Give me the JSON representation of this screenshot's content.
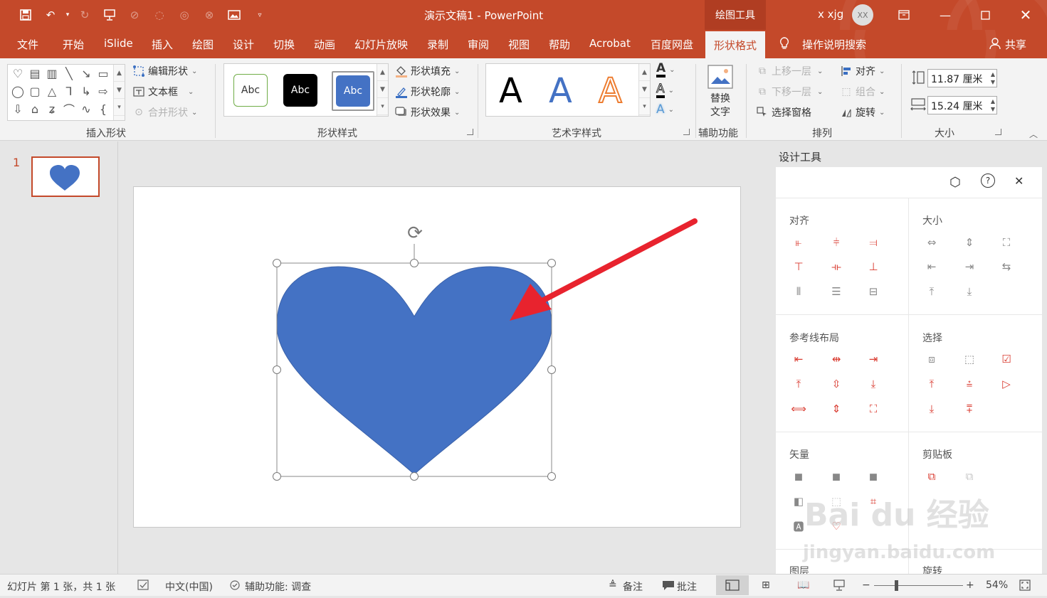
{
  "window": {
    "title": "演示文稿1 - PowerPoint",
    "context_label": "绘图工具",
    "user": "x xjg",
    "avatar": "XX"
  },
  "tabs": [
    "文件",
    "开始",
    "iSlide",
    "插入",
    "绘图",
    "设计",
    "切换",
    "动画",
    "幻灯片放映",
    "录制",
    "审阅",
    "视图",
    "帮助",
    "Acrobat",
    "百度网盘",
    "形状格式"
  ],
  "active_tab": "形状格式",
  "tell_me": "操作说明搜索",
  "share": "共享",
  "ribbon": {
    "insert_shapes": {
      "label": "插入形状",
      "edit_shape": "编辑形状",
      "text_box": "文本框",
      "merge_shapes": "合并形状"
    },
    "shape_styles": {
      "label": "形状样式",
      "swatch_text": "Abc",
      "fill": "形状填充",
      "outline": "形状轮廓",
      "effects": "形状效果"
    },
    "wordart": {
      "label": "艺术字样式",
      "letter": "A"
    },
    "accessibility": {
      "label": "辅助功能",
      "alt_text_line1": "替换",
      "alt_text_line2": "文字"
    },
    "arrange": {
      "label": "排列",
      "bring_forward": "上移一层",
      "send_backward": "下移一层",
      "selection_pane": "选择窗格",
      "align": "对齐",
      "group": "组合",
      "rotate": "旋转"
    },
    "size": {
      "label": "大小",
      "height": "11.87 厘米",
      "width": "15.24 厘米"
    }
  },
  "thumbnail": {
    "number": "1"
  },
  "panel": {
    "title": "设计工具",
    "sections": {
      "align": "对齐",
      "size": "大小",
      "guides": "参考线布局",
      "select": "选择",
      "vector": "矢量",
      "clipboard": "剪贴板",
      "layer": "图层",
      "rotate": "旋转"
    }
  },
  "status": {
    "slide_info": "幻灯片 第 1 张，共 1 张",
    "language": "中文(中国)",
    "accessibility": "辅助功能: 调查",
    "notes": "备注",
    "comments": "批注",
    "zoom": "54%",
    "zoom_fraction": 0.54
  },
  "watermark": {
    "brand": "Bai du 经验",
    "url": "jingyan.baidu.com"
  },
  "colors": {
    "accent": "#c4492a",
    "heart": "#4472c4",
    "arrow": "#e8232e",
    "panel_icon": "#d93a2f"
  }
}
